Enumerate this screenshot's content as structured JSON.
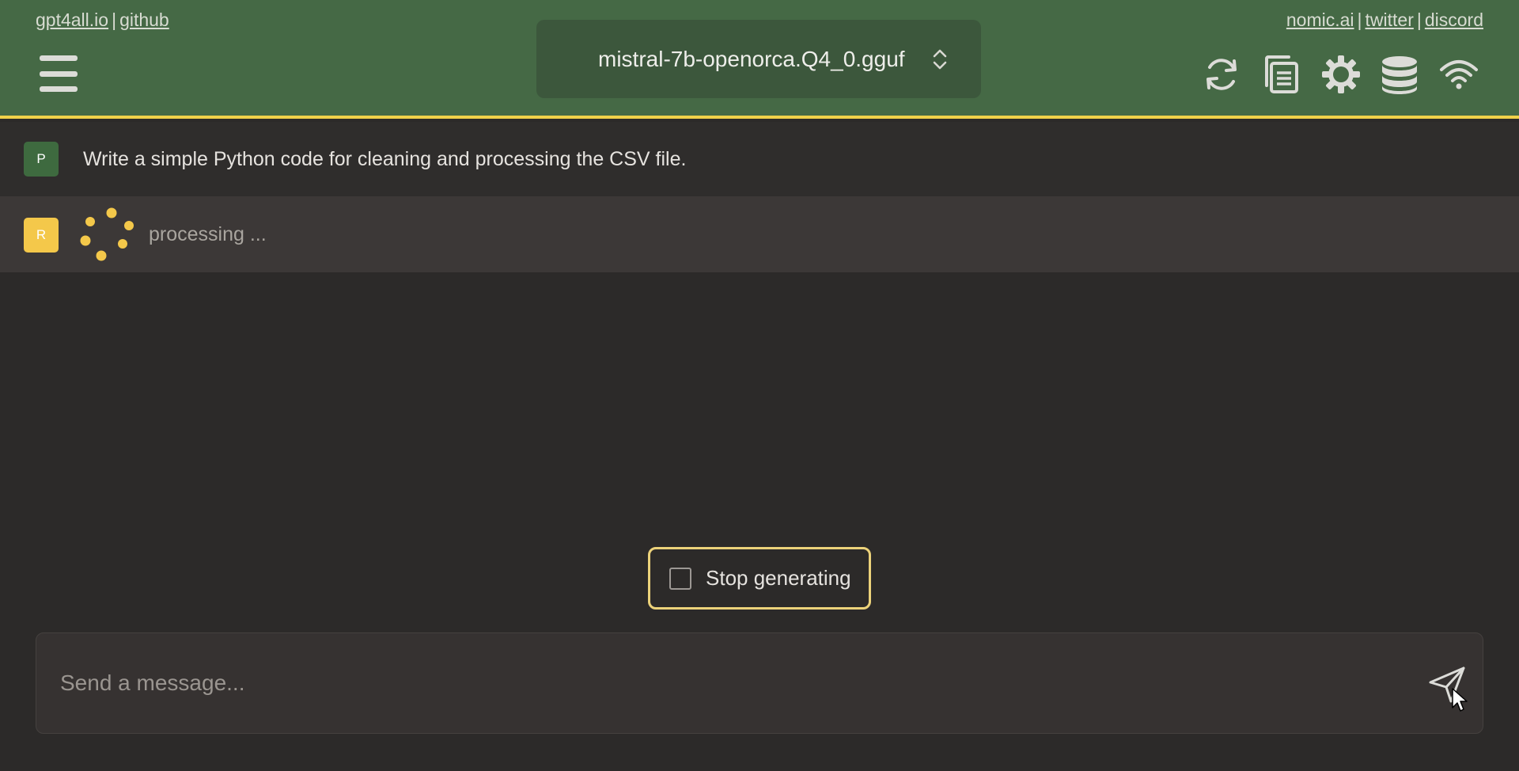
{
  "header": {
    "links_left": [
      "gpt4all.io",
      "github"
    ],
    "links_right": [
      "nomic.ai",
      "twitter",
      "discord"
    ],
    "separator": "|",
    "model_name": "mistral-7b-openorca.Q4_0.gguf",
    "icons": [
      "hamburger-menu-icon",
      "reset-chat-icon",
      "copy-conversation-icon",
      "settings-gear-icon",
      "database-icon",
      "network-wifi-icon"
    ],
    "accent_color": "#f0d14a",
    "background_color": "#456945"
  },
  "conversation": {
    "prompt": {
      "avatar_letter": "P",
      "text": "Write a simple Python code for cleaning and processing the CSV file."
    },
    "response": {
      "avatar_letter": "R",
      "status_text": "processing ..."
    }
  },
  "controls": {
    "stop_label": "Stop generating"
  },
  "input": {
    "placeholder": "Send a message...",
    "value": ""
  }
}
